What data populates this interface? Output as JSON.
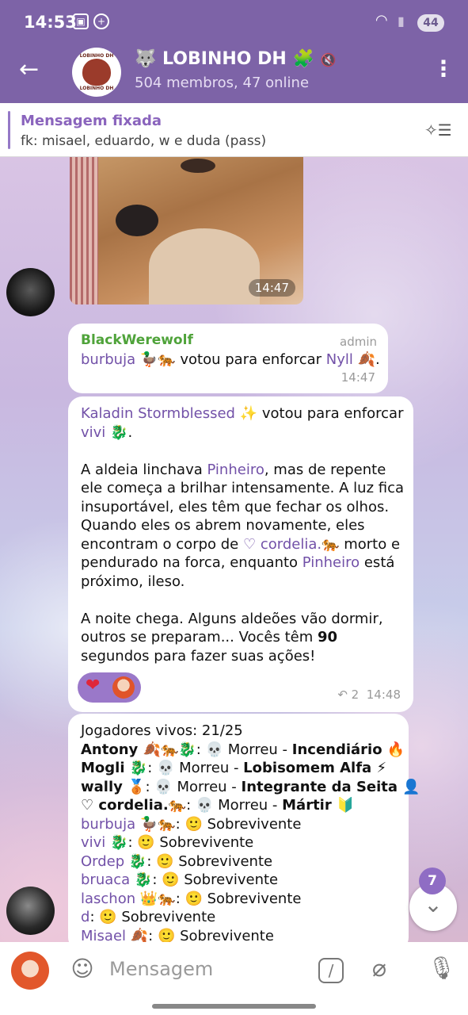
{
  "status": {
    "time": "14:53",
    "battery": "44"
  },
  "header": {
    "title": "🐺 LOBINHO DH 🧩",
    "subtitle": "504 membros, 47 online",
    "avatar_text": "LOBINHO DH"
  },
  "pinned": {
    "title": "Mensagem fixada",
    "text": "fk: misael, eduardo, w e duda (pass)"
  },
  "photo": {
    "time": "14:47"
  },
  "msg1": {
    "sender": "BlackWerewolf",
    "role": "admin",
    "voter": "burbuja 🦆🐅",
    "action": " votou para enforcar ",
    "target": "Nyll 🍂",
    "dot": ".",
    "time": "14:47"
  },
  "msg2": {
    "voter": "Kaladin Stormblessed ✨",
    "action": " votou para enforcar ",
    "target": "vivi 🐉",
    "dot": ".",
    "p2_a": "A aldeia linchava ",
    "p2_b": "Pinheiro",
    "p2_c": ", mas de repente ele começa a brilhar intensamente. A luz fica insuportável, eles têm que fechar os olhos. Quando eles os abrem novamente, eles encontram o corpo de ",
    "p2_d": "♡ cordelia.🐅",
    "p2_e": " morto e pendurado na forca, enquanto ",
    "p2_f": "Pinheiro",
    "p2_g": " está próximo, ileso.",
    "p3_a": "A noite chega. Alguns aldeões vão dormir, outros se preparam... Vocês têm ",
    "p3_b": "90",
    "p3_c": " segundos para fazer suas ações!",
    "reaction": "❤",
    "replies": "↶ 2",
    "time": "14:48"
  },
  "msg3": {
    "header": "Jogadores vivos: 21/25",
    "players": [
      {
        "name": "Antony 🍂🐅🐉",
        "sep": ": 💀 Morreu - ",
        "role": "Incendiário 🔥"
      },
      {
        "name": "Mogli 🐉",
        "sep": ": 💀 Morreu - ",
        "role": "Lobisomem Alfa ⚡"
      },
      {
        "name": "wally 🥉",
        "sep": ": 💀 Morreu - ",
        "role": "Integrante da Seita 👤"
      },
      {
        "name": "♡ cordelia.🐅",
        "sep": ": 💀 Morreu - ",
        "role": "Mártir 🔰"
      }
    ],
    "alive": [
      {
        "name": "burbuja 🦆🐅",
        "status": ": 🙂 Sobrevivente"
      },
      {
        "name": "vivi 🐉",
        "status": ": 🙂 Sobrevivente"
      },
      {
        "name": "Ordep 🐉",
        "status": ": 🙂 Sobrevivente"
      },
      {
        "name": "bruaca 🐉",
        "status": ": 🙂 Sobrevivente"
      },
      {
        "name": "laschon 👑🐅",
        "status": ": 🙂 Sobrevivente"
      },
      {
        "name": "d",
        "status": ": 🙂 Sobrevivente"
      },
      {
        "name": "Misael 🍂",
        "status": ": 🙂 Sobrevivente"
      }
    ]
  },
  "scroll": {
    "unread": "7"
  },
  "input": {
    "placeholder": "Mensagem"
  }
}
